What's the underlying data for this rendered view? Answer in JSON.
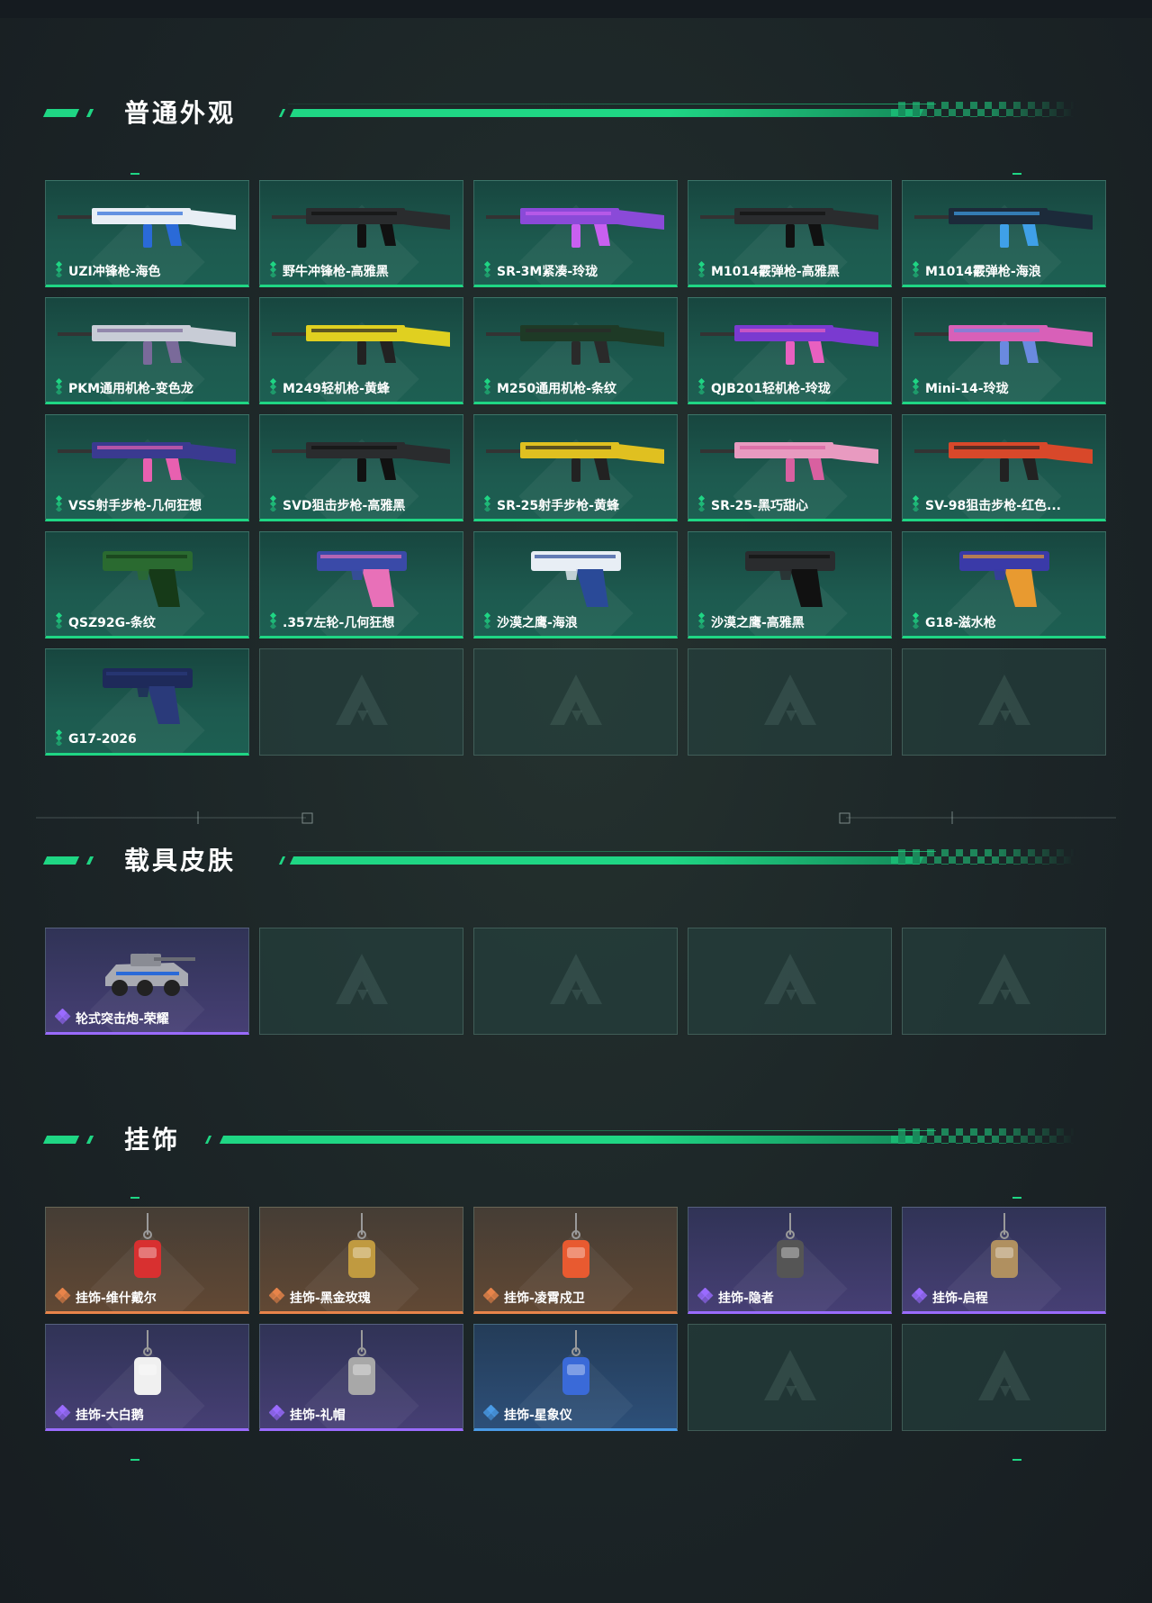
{
  "sections": [
    {
      "title": "普通外观",
      "items": [
        {
          "name": "UZI冲锋枪-海色",
          "rarity": "green"
        },
        {
          "name": "野牛冲锋枪-高雅黑",
          "rarity": "green"
        },
        {
          "name": "SR-3M紧凑-玲珑",
          "rarity": "green"
        },
        {
          "name": "M1014霰弹枪-高雅黑",
          "rarity": "green"
        },
        {
          "name": "M1014霰弹枪-海浪",
          "rarity": "green"
        },
        {
          "name": "PKM通用机枪-变色龙",
          "rarity": "green"
        },
        {
          "name": "M249轻机枪-黄蜂",
          "rarity": "green"
        },
        {
          "name": "M250通用机枪-条纹",
          "rarity": "green"
        },
        {
          "name": "QJB201轻机枪-玲珑",
          "rarity": "green"
        },
        {
          "name": "Mini-14-玲珑",
          "rarity": "green"
        },
        {
          "name": "VSS射手步枪-几何狂想",
          "rarity": "green"
        },
        {
          "name": "SVD狙击步枪-高雅黑",
          "rarity": "green"
        },
        {
          "name": "SR-25射手步枪-黄蜂",
          "rarity": "green"
        },
        {
          "name": "SR-25-黑巧甜心",
          "rarity": "green"
        },
        {
          "name": "SV-98狙击步枪-红色...",
          "rarity": "green"
        },
        {
          "name": "QSZ92G-条纹",
          "rarity": "green"
        },
        {
          "name": ".357左轮-几何狂想",
          "rarity": "green"
        },
        {
          "name": "沙漠之鹰-海浪",
          "rarity": "green"
        },
        {
          "name": "沙漠之鹰-高雅黑",
          "rarity": "green"
        },
        {
          "name": "G18-滋水枪",
          "rarity": "green"
        },
        {
          "name": "G17-2026",
          "rarity": "green"
        }
      ],
      "empty_slots": 4
    },
    {
      "title": "载具皮肤",
      "items": [
        {
          "name": "轮式突击炮-荣耀",
          "rarity": "purple"
        }
      ],
      "empty_slots": 4
    },
    {
      "title": "挂饰",
      "items": [
        {
          "name": "挂饰-维什戴尔",
          "rarity": "orange"
        },
        {
          "name": "挂饰-黑金玫瑰",
          "rarity": "orange"
        },
        {
          "name": "挂饰-凌霄戍卫",
          "rarity": "orange"
        },
        {
          "name": "挂饰-隐者",
          "rarity": "purple"
        },
        {
          "name": "挂饰-启程",
          "rarity": "purple"
        },
        {
          "name": "挂饰-大白鹅",
          "rarity": "purple"
        },
        {
          "name": "挂饰-礼帽",
          "rarity": "purple"
        },
        {
          "name": "挂饰-星象仪",
          "rarity": "blue"
        }
      ],
      "empty_slots": 2
    }
  ],
  "colors": {
    "accent": "#1fd684",
    "green": "#1fd684",
    "purple": "#9a6bff",
    "orange": "#e8844a",
    "blue": "#4a9be6"
  }
}
